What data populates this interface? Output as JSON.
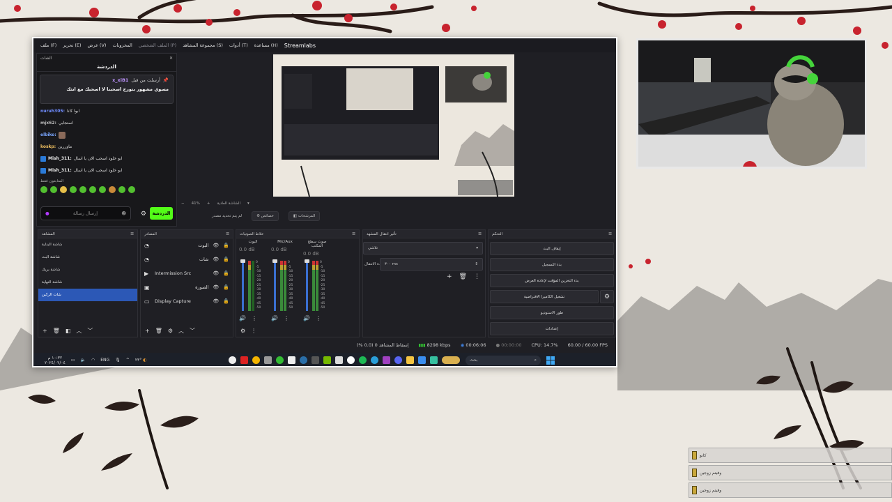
{
  "obs": {
    "menu": [
      "ملف (F)",
      "تحرير (E)",
      "عرض (V)",
      "المخزونات",
      "الملف الشخصي (P)",
      "مجموعة المشاهد (S)",
      "أدوات (T)",
      "مساعدة (H)",
      "Streamlabs"
    ],
    "chat": {
      "dock_title": "الشات",
      "title": "الدردشة",
      "pinned_user": "x_xiB1",
      "pinned_by": "أرسلت من قبل",
      "pinned_text": "مسوي مشهور بتورح اسحبنا لا اسحبك مع انثك",
      "messages": [
        {
          "user": "nuruh305:",
          "text": "ابوا كانا",
          "color": "#6f8cff"
        },
        {
          "user": "mjx62:",
          "text": "استجابي",
          "color": "#bbbbbb"
        },
        {
          "user": "elbiko:",
          "text": "",
          "color": "#7aa6ff"
        },
        {
          "user": "koskp:",
          "text": "ماوررين",
          "color": "#f0c060"
        },
        {
          "user": "Mish_311:",
          "text": "ابو خلود اسحب الان يا اسال",
          "color": "#e6e6e6"
        },
        {
          "user": "Mish_311:",
          "text": "ابو خلود اسحب الان يا اسال",
          "color": "#e6e6e6"
        }
      ],
      "mod_label": "المتابعون فقط",
      "input_placeholder": "إرسال رسالة",
      "send_label": "الدردشة"
    },
    "zoom": "41%",
    "zoom_label": "الشاشة العادية",
    "controls_row": {
      "no_scene": "لم يتم تحديد مصدر",
      "properties": "خصائص",
      "filters": "المرشحات"
    },
    "scenes": {
      "title": "المشاهد",
      "items": [
        "شاشة البداية",
        "شاشة البث",
        "شاشة بريك",
        "شاشة النهاية",
        "شات الزكين"
      ],
      "selected_index": 4
    },
    "sources": {
      "title": "المصادر",
      "items": [
        {
          "name": "البوت",
          "icon": "gauge-icon"
        },
        {
          "name": "شات",
          "icon": "gauge-icon"
        },
        {
          "name": "Intermission Src",
          "icon": "play-icon"
        },
        {
          "name": "الصورة",
          "icon": "image-icon"
        },
        {
          "name": "Display Capture",
          "icon": "monitor-icon"
        }
      ]
    },
    "mixer": {
      "title": "خلاط الصوتيات",
      "channels": [
        {
          "name": "البوت",
          "db": "0.0 dB"
        },
        {
          "name": "Mic/Aux",
          "db": "0.0 dB"
        },
        {
          "name": "صوت سطح المكتب",
          "db": "0.0 dB"
        }
      ],
      "ticks": [
        "0",
        "-5",
        "-10",
        "-15",
        "-20",
        "-25",
        "-30",
        "-35",
        "-40",
        "-45",
        "-50",
        "-55",
        "-60"
      ]
    },
    "transitions": {
      "title": "تأثير انتقال المشهد",
      "type": "تلاشي",
      "duration_label": "مدة الانتقال",
      "duration": "٣٠٠ ms"
    },
    "controls": {
      "title": "التحكم",
      "buttons": [
        "إيقاف البث",
        "بدء التسجيل",
        "بدء التخزين المؤقت لإعادة العرض",
        "تشغيل الكاميرا الافتراضية",
        "طور الاستوديو",
        "إعدادات"
      ]
    },
    "status": {
      "dropped": "إسقاط المشاهد 0 (0.0 %)",
      "bitrate": "8298 kbps",
      "stream_time": "00:06:06",
      "rec_time": "00:00:00",
      "cpu": "CPU: 14.7%",
      "fps": "60.00 / 60.00 FPS"
    },
    "taskbar": {
      "time": "١٠:٣٢ م",
      "date": "٢٠٢٤/٠٢/٠٤",
      "lang": "ENG",
      "weather": "٢٣°",
      "search_placeholder": "بحث"
    }
  },
  "overlay_rows": [
    "كانو",
    "وفيتم زوجين",
    "وفيتم زوجين"
  ],
  "colors": {
    "accent": "#2c58b6",
    "kick_green": "#53fc18",
    "twitch_purple": "#bf94ff"
  }
}
